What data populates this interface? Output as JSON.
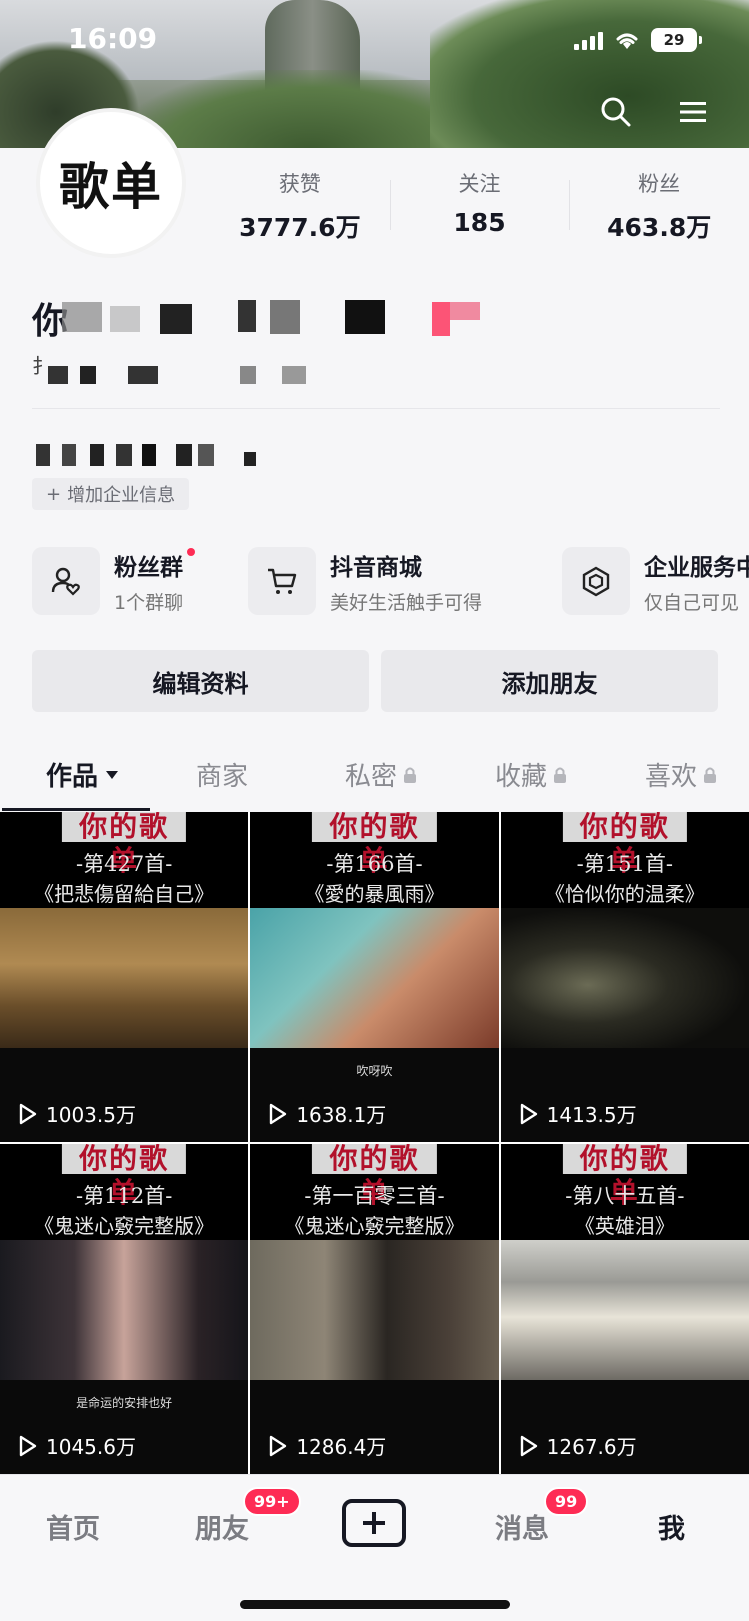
{
  "status_bar": {
    "time": "16:09",
    "battery": "29"
  },
  "profile": {
    "avatar_text": "歌单",
    "name_prefix": "你",
    "sub_prefix": "扌",
    "stats": [
      {
        "label": "获赞",
        "value": "3777.6万"
      },
      {
        "label": "关注",
        "value": "185"
      },
      {
        "label": "粉丝",
        "value": "463.8万"
      }
    ],
    "business_tag": "增加企业信息"
  },
  "services": [
    {
      "title": "粉丝群",
      "subtitle": "1个群聊",
      "icon": "fan-group-icon"
    },
    {
      "title": "抖音商城",
      "subtitle": "美好生活触手可得",
      "icon": "cart-icon"
    },
    {
      "title": "企业服务中",
      "subtitle": "仅自己可见",
      "icon": "enterprise-icon"
    }
  ],
  "buttons": {
    "edit": "编辑资料",
    "add_friend": "添加朋友"
  },
  "tabs": [
    {
      "label": "作品",
      "active": true
    },
    {
      "label": "商家"
    },
    {
      "label": "私密",
      "locked": true
    },
    {
      "label": "收藏",
      "locked": true
    },
    {
      "label": "喜欢",
      "locked": true
    }
  ],
  "videos": [
    {
      "title": "你的歌单",
      "number": "-第427首-",
      "song": "《把悲傷留給自己》",
      "caption": "",
      "plays": "1003.5万"
    },
    {
      "title": "你的歌单",
      "number": "-第166首-",
      "song": "《愛的暴風雨》",
      "caption": "吹呀吹",
      "plays": "1638.1万"
    },
    {
      "title": "你的歌单",
      "number": "-第151首-",
      "song": "《恰似你的温柔》",
      "caption": "",
      "plays": "1413.5万"
    },
    {
      "title": "你的歌单",
      "number": "-第112首-",
      "song": "《鬼迷心竅完整版》",
      "caption": "是命运的安排也好",
      "plays": "1045.6万"
    },
    {
      "title": "你的歌单",
      "number": "-第一百零三首-",
      "song": "《鬼迷心竅完整版》",
      "caption": "",
      "plays": "1286.4万"
    },
    {
      "title": "你的歌单",
      "number": "-第八十五首-",
      "song": "《英雄泪》",
      "caption": "",
      "plays": "1267.6万"
    }
  ],
  "bottom_nav": {
    "home": "首页",
    "friends": "朋友",
    "friends_badge": "99+",
    "messages": "消息",
    "messages_badge": "99",
    "me": "我"
  },
  "colors": {
    "accent": "#fe2c55",
    "title_red": "#b2112b"
  }
}
